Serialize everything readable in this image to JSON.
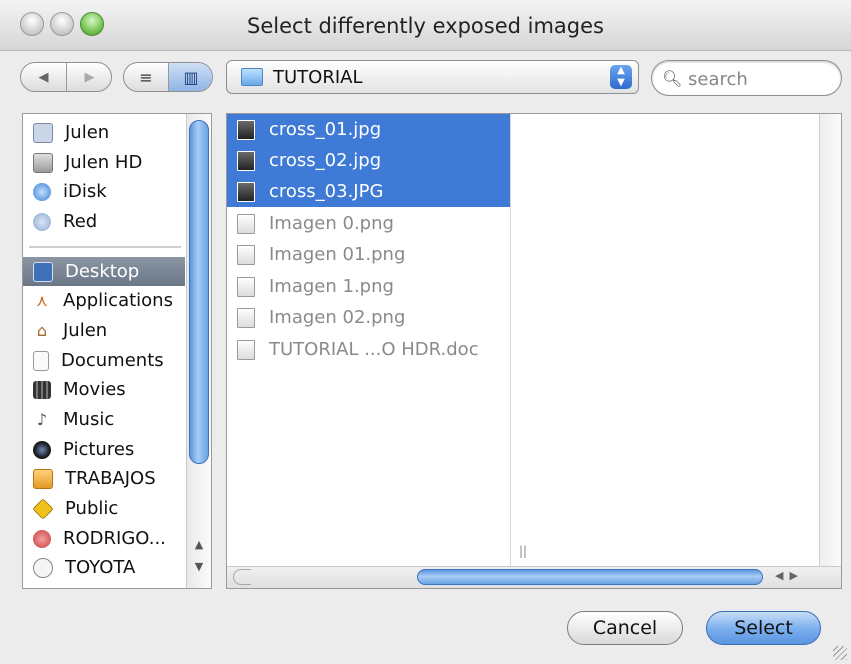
{
  "window": {
    "title": "Select differently exposed images"
  },
  "toolbar": {
    "back_glyph": "◀",
    "forward_glyph": "▶",
    "list_view_glyph": "≡",
    "column_view_glyph": "▥",
    "path_label": "TUTORIAL",
    "path_arrows": "▲▼",
    "search_placeholder": "search"
  },
  "sidebar": {
    "devices": [
      {
        "label": "Julen",
        "icon": "computer-icon"
      },
      {
        "label": "Julen HD",
        "icon": "hard-drive-icon"
      },
      {
        "label": "iDisk",
        "icon": "idisk-icon"
      },
      {
        "label": "Red",
        "icon": "network-icon"
      }
    ],
    "places": [
      {
        "label": "Desktop",
        "icon": "desktop-icon",
        "selected": true
      },
      {
        "label": "Applications",
        "icon": "applications-icon"
      },
      {
        "label": "Julen",
        "icon": "home-icon"
      },
      {
        "label": "Documents",
        "icon": "documents-icon"
      },
      {
        "label": "Movies",
        "icon": "movies-icon"
      },
      {
        "label": "Music",
        "icon": "music-icon"
      },
      {
        "label": "Pictures",
        "icon": "pictures-icon"
      },
      {
        "label": "TRABAJOS",
        "icon": "folder-icon"
      },
      {
        "label": "Public",
        "icon": "public-icon"
      },
      {
        "label": "RODRIGO...",
        "icon": "rodrigo-icon"
      },
      {
        "label": "TOYOTA",
        "icon": "toyota-icon"
      }
    ]
  },
  "files": [
    {
      "name": "cross_01.jpg",
      "selected": true,
      "enabled": true
    },
    {
      "name": "cross_02.jpg",
      "selected": true,
      "enabled": true
    },
    {
      "name": "cross_03.JPG",
      "selected": true,
      "enabled": true
    },
    {
      "name": "Imagen 0.png",
      "selected": false,
      "enabled": false
    },
    {
      "name": "Imagen 01.png",
      "selected": false,
      "enabled": false
    },
    {
      "name": "Imagen 1.png",
      "selected": false,
      "enabled": false
    },
    {
      "name": "Imagen 02.png",
      "selected": false,
      "enabled": false
    },
    {
      "name": "TUTORIAL ...O HDR.doc",
      "selected": false,
      "enabled": false
    }
  ],
  "buttons": {
    "cancel": "Cancel",
    "select": "Select"
  },
  "colors": {
    "selection": "#3e7ad6",
    "sidebar_selection": "#6b7686",
    "default_button": "#5a95e0"
  }
}
